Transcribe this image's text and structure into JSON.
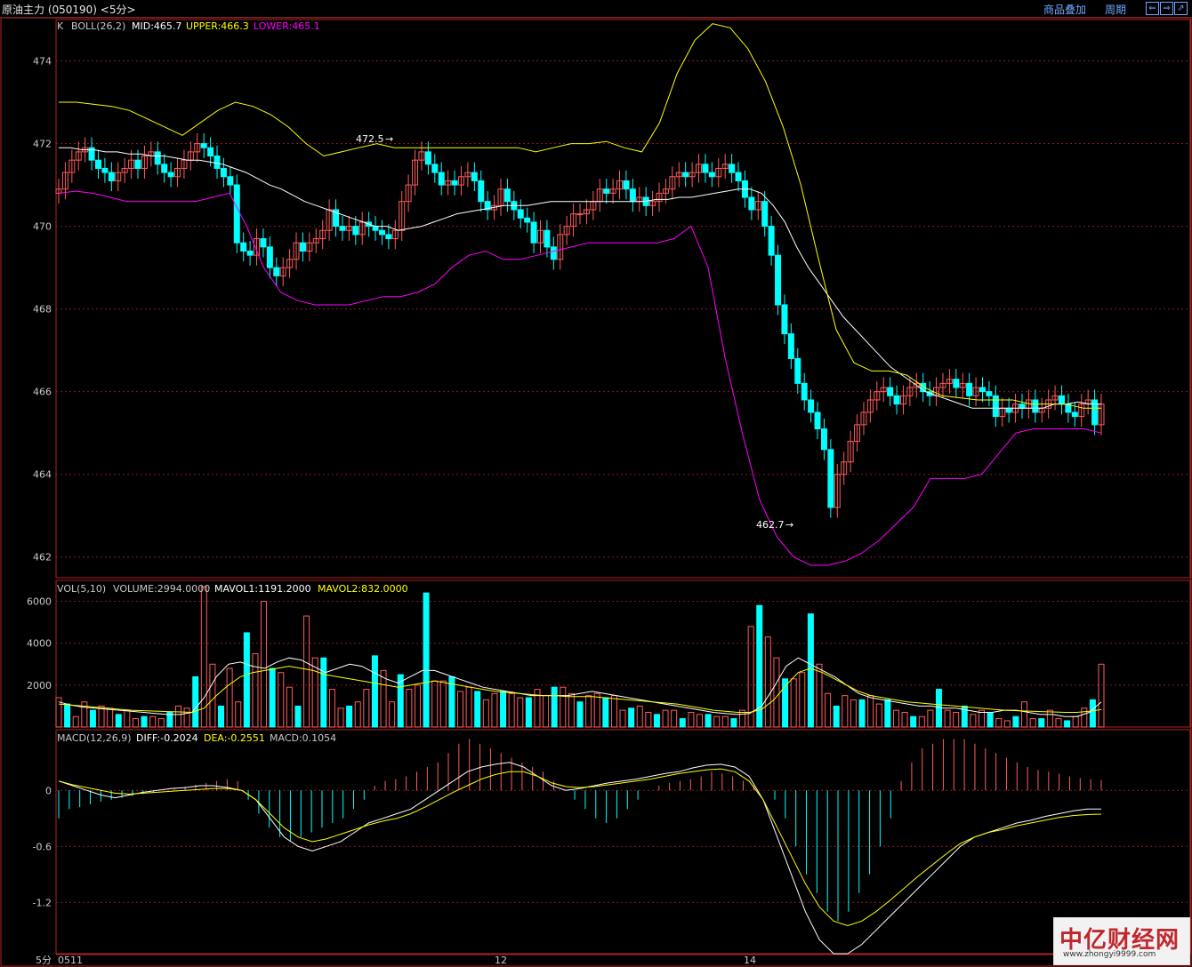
{
  "window": {
    "title": "原油主力 (050190) <5分>",
    "buttons": [
      "商品叠加",
      "周期"
    ],
    "nav_icons": [
      "arrow-left-icon",
      "arrow-right-icon",
      "arrow-expand-icon"
    ]
  },
  "colors": {
    "background": "#000000",
    "frame": "#b22222",
    "grid": "#8b1a1a",
    "up_candle": "#ff5b5b",
    "down_candle": "#00ffff",
    "mid_line": "#ffffff",
    "upper_line": "#ffff00",
    "lower_line": "#ff00ff",
    "dea_line": "#ffff00",
    "diff_line": "#ffffff"
  },
  "price_panel": {
    "legend": {
      "k": "K",
      "boll": "BOLL(26,2)",
      "mid": "MID:465.7",
      "upper": "UPPER:466.3",
      "lower": "LOWER:465.1"
    },
    "y_ticks": [
      "474",
      "472",
      "470",
      "468",
      "466",
      "464",
      "462"
    ],
    "annotations": {
      "high": "472.5",
      "low": "462.7"
    }
  },
  "volume_panel": {
    "legend": {
      "vol": "VOL(5,10)",
      "volume": "VOLUME:2994.0000",
      "mavol1": "MAVOL1:1191.2000",
      "mavol2": "MAVOL2:832.0000"
    },
    "y_ticks": [
      "6000",
      "4000",
      "2000"
    ]
  },
  "macd_panel": {
    "legend": {
      "macd": "MACD(12,26,9)",
      "diff": "DIFF:-0.2024",
      "dea": "DEA:-0.2551",
      "macd_val": "MACD:0.1054"
    },
    "y_ticks": [
      "0",
      "-0.6",
      "-1.2"
    ]
  },
  "x_axis": {
    "period": "5分",
    "labels": [
      "0511",
      "12",
      "14"
    ]
  },
  "watermark": {
    "logo": "中亿财经网",
    "url": "www.zhongyi9999.com"
  },
  "chart_data": {
    "type": "candlestick",
    "title": "原油主力 (050190)",
    "period": "5分",
    "x_labels": [
      "0511",
      "12",
      "14"
    ],
    "ylim_price": [
      461.5,
      475.0
    ],
    "ylim_volume": [
      0,
      7000
    ],
    "ylim_macd": [
      -1.75,
      0.65
    ],
    "annotations": [
      {
        "label": "472.5",
        "value": 472.5
      },
      {
        "label": "462.7",
        "value": 462.7
      }
    ],
    "close": [
      470.9,
      471.3,
      471.6,
      471.8,
      471.9,
      471.6,
      471.4,
      471.3,
      471.1,
      471.3,
      471.4,
      471.6,
      471.4,
      471.7,
      471.8,
      471.5,
      471.3,
      471.2,
      471.4,
      471.6,
      471.8,
      472.0,
      471.9,
      471.7,
      471.4,
      471.2,
      471.0,
      469.6,
      469.4,
      469.3,
      469.7,
      469.5,
      469.0,
      468.8,
      469.0,
      469.2,
      469.6,
      469.4,
      469.6,
      469.7,
      469.9,
      470.4,
      470.0,
      469.9,
      470.0,
      469.8,
      470.1,
      470.0,
      469.9,
      469.8,
      469.7,
      469.9,
      470.6,
      471.0,
      471.6,
      471.8,
      471.5,
      471.3,
      471.0,
      471.1,
      471.0,
      471.2,
      471.3,
      471.1,
      470.6,
      470.4,
      470.5,
      470.9,
      470.6,
      470.4,
      470.2,
      470.1,
      469.6,
      469.9,
      469.5,
      469.2,
      469.8,
      470.0,
      470.3,
      470.3,
      470.4,
      470.6,
      470.9,
      470.8,
      470.9,
      471.1,
      470.9,
      470.6,
      470.7,
      470.5,
      470.6,
      470.8,
      470.9,
      471.2,
      471.3,
      471.2,
      471.3,
      471.5,
      471.3,
      471.2,
      471.4,
      471.5,
      471.3,
      471.1,
      470.7,
      470.4,
      470.6,
      470.0,
      469.3,
      468.1,
      467.4,
      466.8,
      466.2,
      465.8,
      465.5,
      465.1,
      464.6,
      463.2,
      464.0,
      464.3,
      464.8,
      465.2,
      465.5,
      465.8,
      466.0,
      466.1,
      465.9,
      465.7,
      465.9,
      466.1,
      466.2,
      466.0,
      465.9,
      466.1,
      466.2,
      466.3,
      466.1,
      466.2,
      465.9,
      466.1,
      466.0,
      465.9,
      465.4,
      465.6,
      465.5,
      465.7,
      465.6,
      465.8,
      465.5,
      465.6,
      465.8,
      465.9,
      465.7,
      465.5,
      465.4,
      465.7,
      465.8,
      465.2,
      465.7
    ],
    "boll_mid": [
      471.9,
      471.9,
      471.85,
      471.85,
      471.8,
      471.8,
      471.75,
      471.75,
      471.7,
      471.7,
      471.65,
      471.6,
      471.6,
      471.55,
      471.5,
      471.4,
      471.3,
      471.15,
      471.0,
      470.9,
      470.75,
      470.6,
      470.5,
      470.4,
      470.3,
      470.2,
      470.1,
      470.0,
      470.0,
      469.9,
      469.95,
      470.0,
      470.1,
      470.2,
      470.3,
      470.35,
      470.4,
      470.45,
      470.5,
      470.5,
      470.5,
      470.55,
      470.6,
      470.6,
      470.6,
      470.6,
      470.6,
      470.6,
      470.6,
      470.6,
      470.6,
      470.65,
      470.65,
      470.7,
      470.7,
      470.75,
      470.8,
      470.85,
      470.9,
      470.9,
      470.8,
      470.5,
      470.1,
      469.5,
      469.0,
      468.6,
      468.2,
      467.8,
      467.5,
      467.2,
      466.9,
      466.6,
      466.4,
      466.2,
      466.0,
      465.9,
      465.8,
      465.7,
      465.6,
      465.6,
      465.6,
      465.6,
      465.6,
      465.6,
      465.6,
      465.7,
      465.7,
      465.75,
      465.7,
      465.7
    ],
    "boll_upper": [
      473.0,
      473.0,
      472.95,
      472.9,
      472.8,
      472.6,
      472.4,
      472.2,
      472.5,
      472.8,
      473.0,
      472.9,
      472.7,
      472.4,
      472.0,
      471.7,
      471.8,
      471.9,
      472.0,
      471.9,
      471.9,
      471.9,
      471.9,
      471.9,
      471.9,
      471.9,
      471.9,
      471.8,
      471.9,
      472.0,
      472.0,
      472.05,
      471.9,
      471.8,
      472.5,
      473.7,
      474.5,
      474.9,
      474.8,
      474.3,
      473.5,
      472.4,
      471.0,
      469.2,
      467.5,
      466.7,
      466.5,
      466.5,
      466.4,
      466.1,
      465.9,
      465.85,
      465.8,
      465.8,
      465.8,
      465.7,
      465.7,
      465.7,
      465.6,
      465.6
    ],
    "boll_lower": [
      470.8,
      470.85,
      470.8,
      470.7,
      470.6,
      470.6,
      470.6,
      470.6,
      470.6,
      470.7,
      470.8,
      470.0,
      469.0,
      468.4,
      468.2,
      468.1,
      468.1,
      468.1,
      468.2,
      468.3,
      468.3,
      468.4,
      468.6,
      469.0,
      469.3,
      469.4,
      469.2,
      469.2,
      469.3,
      469.4,
      469.5,
      469.6,
      469.6,
      469.6,
      469.6,
      469.6,
      469.7,
      470.0,
      469.0,
      466.8,
      465.0,
      463.4,
      462.5,
      462.0,
      461.8,
      461.8,
      461.9,
      462.1,
      462.4,
      462.8,
      463.2,
      463.9,
      463.9,
      463.9,
      464.0,
      464.5,
      465.0,
      465.1,
      465.1,
      465.1,
      465.1,
      465.0
    ],
    "volume": [
      1400,
      1100,
      500,
      1200,
      800,
      1000,
      900,
      600,
      800,
      400,
      500,
      500,
      400,
      700,
      1000,
      900,
      2400,
      6700,
      3000,
      1000,
      2800,
      1200,
      4500,
      3500,
      6000,
      2800,
      2600,
      1900,
      1000,
      5300,
      3300,
      3300,
      1800,
      900,
      1000,
      1200,
      1800,
      3400,
      2700,
      1200,
      2500,
      1800,
      2000,
      6400,
      2200,
      2200,
      2400,
      1700,
      1900,
      1700,
      1300,
      1600,
      1700,
      1600,
      1400,
      1400,
      1800,
      1500,
      1900,
      1900,
      1600,
      1200,
      1500,
      1600,
      1400,
      1500,
      800,
      900,
      1000,
      700,
      600,
      800,
      800,
      400,
      700,
      600,
      600,
      500,
      500,
      400,
      800,
      4800,
      5800,
      4300,
      3300,
      2300,
      2300,
      2600,
      5400,
      3000,
      1600,
      1000,
      1500,
      1300,
      1300,
      1500,
      1100,
      1300,
      800,
      700,
      500,
      500,
      800,
      1800,
      800,
      700,
      1000,
      600,
      800,
      700,
      400,
      300,
      500,
      1200,
      400,
      400,
      800,
      400,
      300,
      500,
      900,
      1300,
      3000
    ],
    "mavol1": [
      1200,
      1050,
      950,
      900,
      850,
      800,
      750,
      700,
      650,
      600,
      600,
      700,
      1400,
      2400,
      3000,
      3100,
      2900,
      2800,
      3100,
      3300,
      3200,
      2900,
      2600,
      2800,
      3000,
      2900,
      2600,
      2300,
      2100,
      2400,
      2700,
      2700,
      2500,
      2300,
      2100,
      1900,
      1800,
      1700,
      1600,
      1500,
      1500,
      1500,
      1500,
      1600,
      1700,
      1600,
      1500,
      1400,
      1300,
      1200,
      1100,
      1000,
      900,
      800,
      700,
      650,
      600,
      650,
      1000,
      1900,
      2900,
      3300,
      3000,
      2700,
      2400,
      2000,
      1600,
      1400,
      1300,
      1200,
      1100,
      1000,
      1000,
      900,
      900,
      800,
      700,
      700,
      800,
      800,
      700,
      600,
      600,
      500,
      500,
      700,
      1191
    ],
    "mavol2": [
      1100,
      1050,
      1000,
      950,
      900,
      850,
      800,
      780,
      760,
      740,
      720,
      700,
      900,
      1500,
      2000,
      2400,
      2600,
      2700,
      2800,
      2900,
      2800,
      2700,
      2500,
      2400,
      2300,
      2200,
      2100,
      2000,
      1900,
      2000,
      2100,
      2200,
      2100,
      2000,
      1900,
      1800,
      1700,
      1650,
      1600,
      1550,
      1500,
      1500,
      1450,
      1450,
      1450,
      1400,
      1350,
      1300,
      1250,
      1200,
      1150,
      1100,
      1000,
      900,
      800,
      750,
      700,
      700,
      850,
      1300,
      2000,
      2600,
      2800,
      2600,
      2300,
      2000,
      1700,
      1500,
      1400,
      1300,
      1200,
      1150,
      1100,
      1050,
      1000,
      950,
      900,
      850,
      800,
      780,
      760,
      740,
      720,
      700,
      700,
      750,
      832
    ],
    "macd_hist": [
      -0.3,
      -0.2,
      -0.18,
      -0.15,
      -0.12,
      -0.1,
      -0.08,
      -0.06,
      -0.04,
      -0.02,
      0.0,
      0.02,
      0.04,
      0.06,
      0.08,
      0.1,
      0.12,
      0.1,
      -0.1,
      -0.25,
      -0.4,
      -0.5,
      -0.55,
      -0.5,
      -0.45,
      -0.4,
      -0.35,
      -0.3,
      -0.2,
      -0.1,
      0.05,
      0.1,
      0.12,
      0.15,
      0.2,
      0.25,
      0.3,
      0.4,
      0.5,
      0.55,
      0.5,
      0.45,
      0.4,
      0.35,
      0.3,
      0.25,
      0.2,
      0.1,
      0.0,
      -0.1,
      -0.2,
      -0.3,
      -0.35,
      -0.3,
      -0.2,
      -0.1,
      0.0,
      0.05,
      0.08,
      0.1,
      0.12,
      0.15,
      0.2,
      0.18,
      0.15,
      0.1,
      0.05,
      0.0,
      -0.1,
      -0.3,
      -0.6,
      -0.9,
      -1.1,
      -1.3,
      -1.4,
      -1.3,
      -1.1,
      -0.9,
      -0.6,
      -0.3,
      0.1,
      0.3,
      0.45,
      0.5,
      0.55,
      0.55,
      0.55,
      0.5,
      0.45,
      0.4,
      0.35,
      0.3,
      0.25,
      0.22,
      0.2,
      0.18,
      0.15,
      0.13,
      0.12,
      0.11
    ],
    "diff": [
      0.1,
      0.05,
      0.0,
      -0.05,
      -0.08,
      -0.05,
      -0.02,
      0.0,
      0.02,
      0.03,
      0.05,
      0.05,
      0.03,
      0.0,
      -0.1,
      -0.3,
      -0.5,
      -0.6,
      -0.65,
      -0.6,
      -0.55,
      -0.45,
      -0.35,
      -0.3,
      -0.25,
      -0.2,
      -0.1,
      0.0,
      0.1,
      0.2,
      0.25,
      0.28,
      0.3,
      0.25,
      0.15,
      0.05,
      0.0,
      0.02,
      0.05,
      0.08,
      0.1,
      0.12,
      0.15,
      0.18,
      0.2,
      0.24,
      0.27,
      0.28,
      0.25,
      0.15,
      -0.1,
      -0.5,
      -0.9,
      -1.3,
      -1.6,
      -1.75,
      -1.75,
      -1.65,
      -1.5,
      -1.35,
      -1.2,
      -1.05,
      -0.9,
      -0.75,
      -0.6,
      -0.5,
      -0.45,
      -0.4,
      -0.35,
      -0.32,
      -0.28,
      -0.25,
      -0.22,
      -0.2,
      -0.2
    ],
    "dea": [
      0.1,
      0.06,
      0.03,
      0.0,
      -0.03,
      -0.04,
      -0.03,
      -0.02,
      -0.01,
      0.0,
      0.01,
      0.02,
      0.02,
      0.0,
      -0.1,
      -0.25,
      -0.4,
      -0.5,
      -0.55,
      -0.52,
      -0.47,
      -0.42,
      -0.37,
      -0.33,
      -0.3,
      -0.25,
      -0.18,
      -0.1,
      -0.02,
      0.05,
      0.12,
      0.17,
      0.2,
      0.2,
      0.15,
      0.08,
      0.04,
      0.03,
      0.04,
      0.06,
      0.08,
      0.1,
      0.12,
      0.15,
      0.18,
      0.2,
      0.22,
      0.23,
      0.2,
      0.1,
      -0.1,
      -0.4,
      -0.7,
      -1.0,
      -1.25,
      -1.4,
      -1.45,
      -1.4,
      -1.3,
      -1.18,
      -1.05,
      -0.92,
      -0.8,
      -0.68,
      -0.57,
      -0.5,
      -0.45,
      -0.42,
      -0.38,
      -0.35,
      -0.32,
      -0.29,
      -0.27,
      -0.26,
      -0.255
    ]
  }
}
